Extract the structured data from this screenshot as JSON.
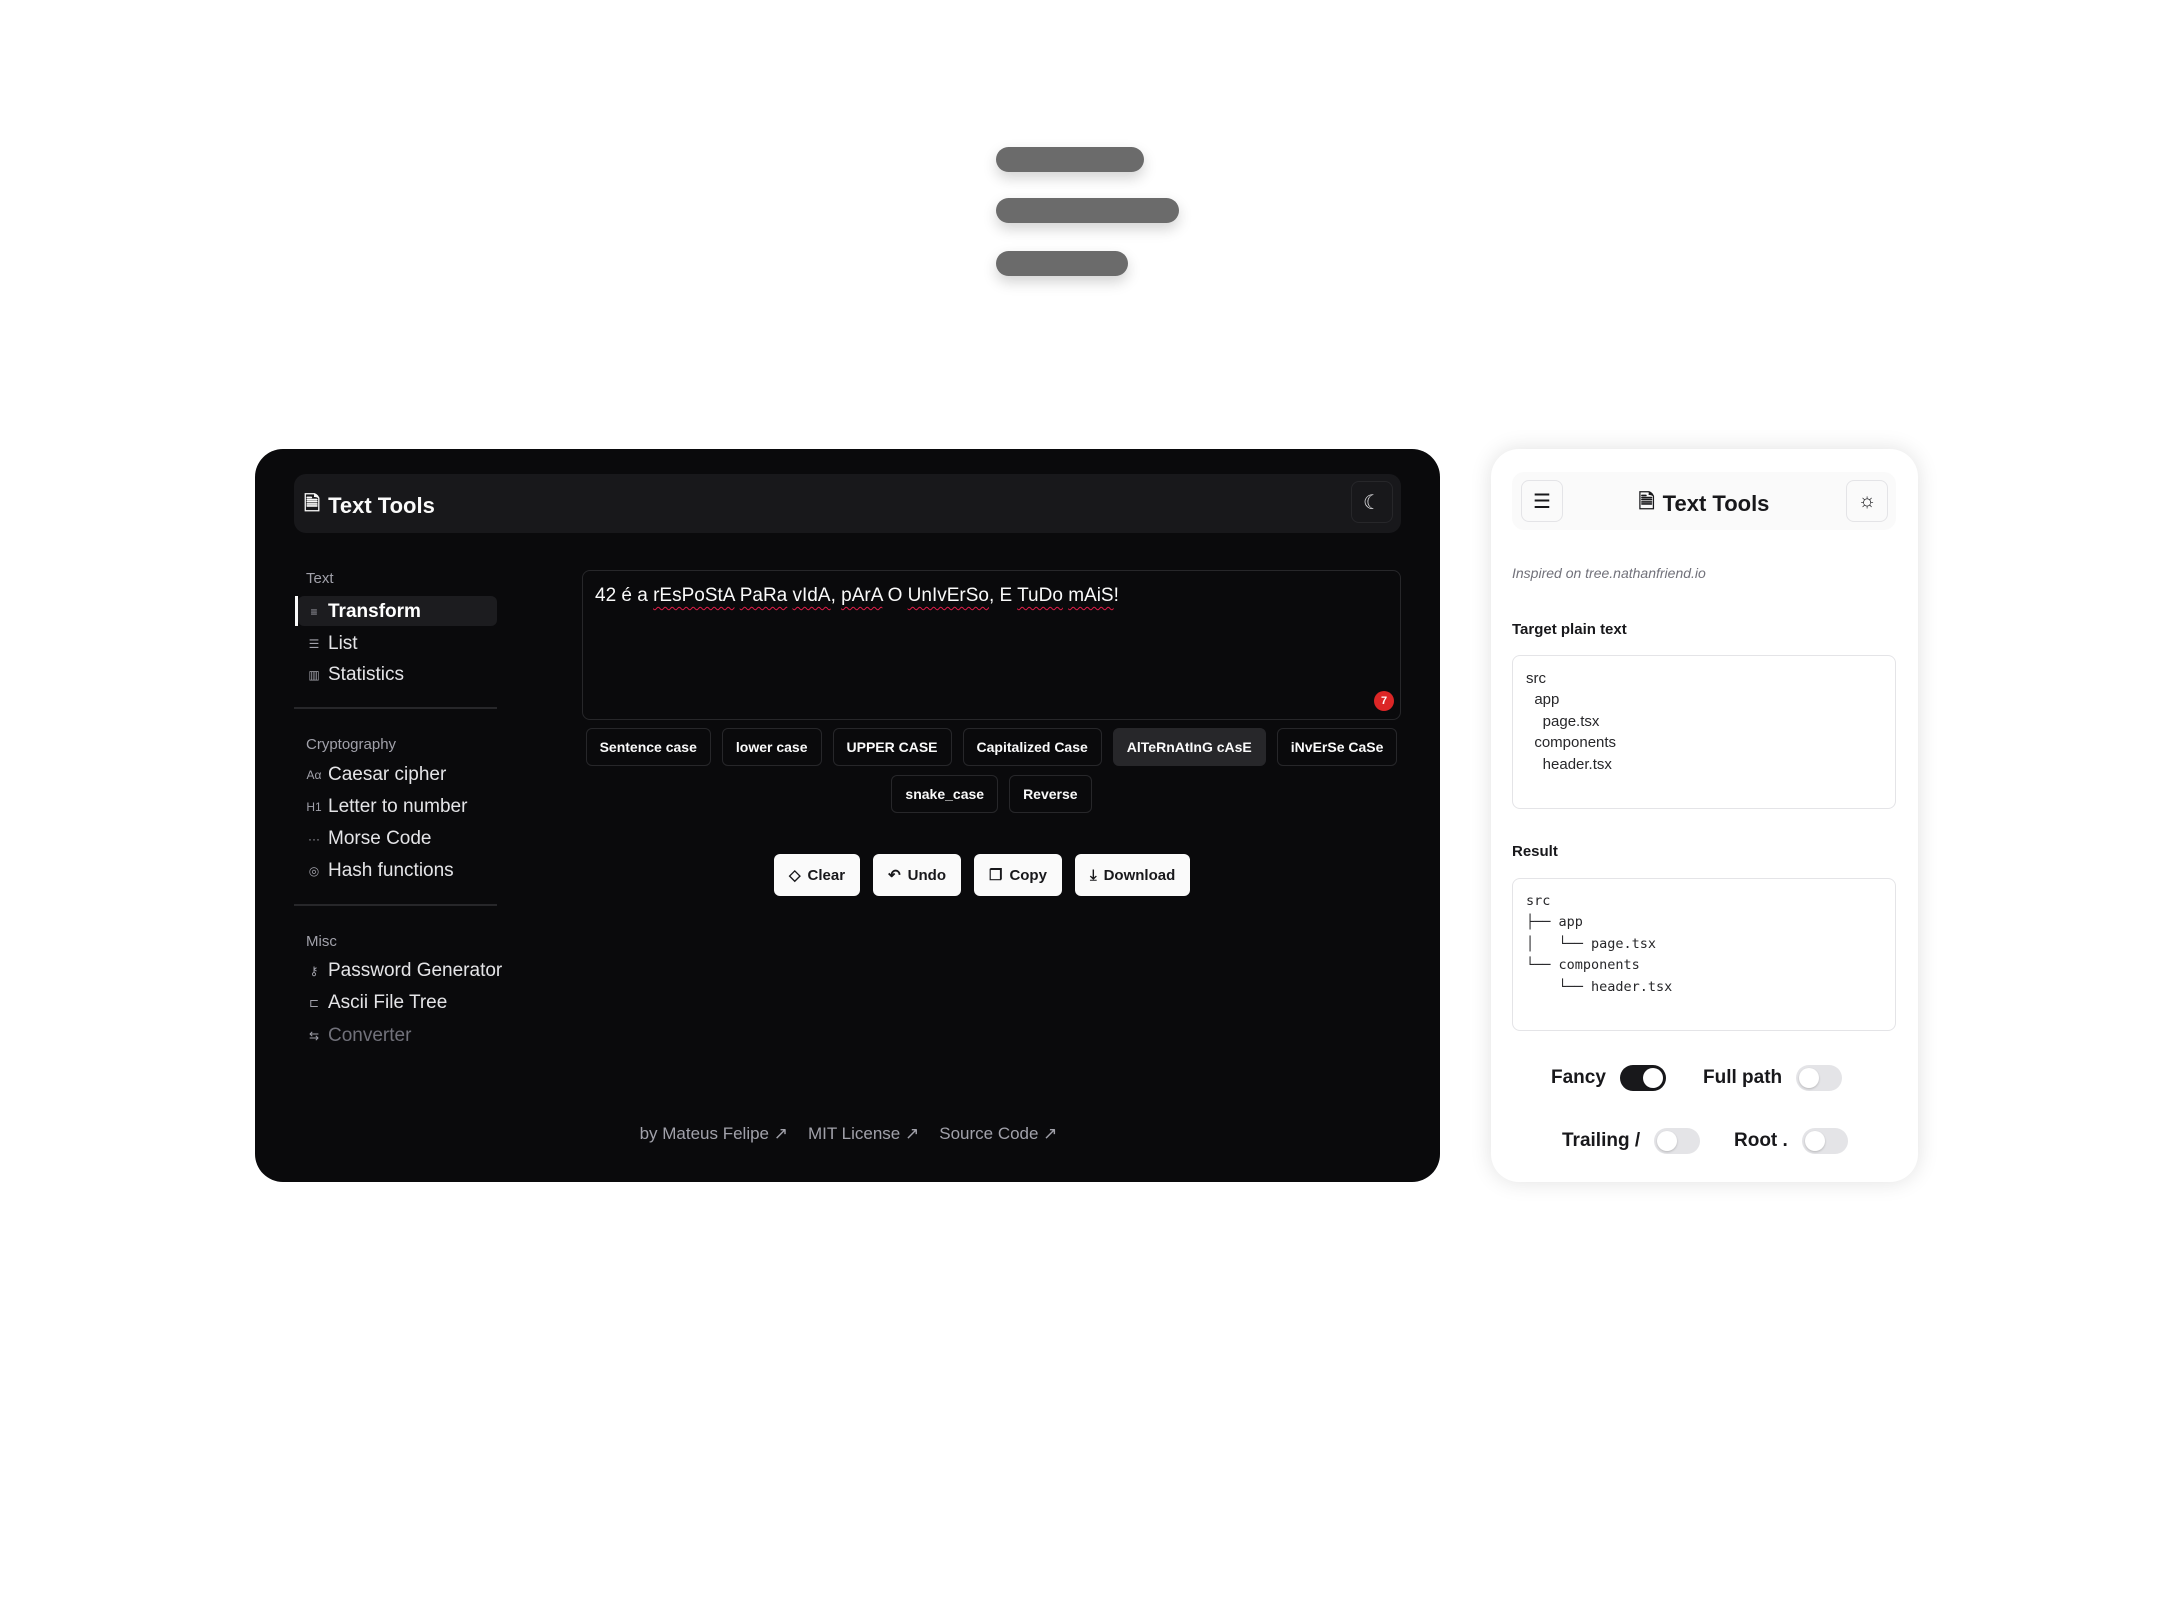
{
  "dark_app": {
    "title": "Text Tools",
    "theme_icon": "moon-icon",
    "sidebar": [
      {
        "section": "Text",
        "items": [
          {
            "label": "Transform",
            "icon": "≡",
            "active": true
          },
          {
            "label": "List",
            "icon": "☰"
          },
          {
            "label": "Statistics",
            "icon": "▥"
          }
        ]
      },
      {
        "section": "Cryptography",
        "items": [
          {
            "label": "Caesar cipher",
            "icon": "Aα"
          },
          {
            "label": "Letter to number",
            "icon": "H1"
          },
          {
            "label": "Morse Code",
            "icon": "···"
          },
          {
            "label": "Hash functions",
            "icon": "◎"
          }
        ]
      },
      {
        "section": "Misc",
        "items": [
          {
            "label": "Password Generator",
            "icon": "⚷"
          },
          {
            "label": "Ascii File Tree",
            "icon": "⊏"
          },
          {
            "label": "Converter",
            "icon": "⇆",
            "disabled": true
          }
        ]
      }
    ],
    "input_text": "42 é a rEsPoStA PaRa vIdA, pArA O UnIvErSo, E TuDo mAiS!",
    "error_count": "7",
    "case_buttons": [
      "Sentence case",
      "lower case",
      "UPPER CASE",
      "Capitalized Case",
      "AlTeRnAtInG cAsE",
      "iNvErSe CaSe"
    ],
    "case_buttons_row2": [
      "snake_case",
      "Reverse"
    ],
    "active_case": "AlTeRnAtInG cAsE",
    "actions": [
      {
        "label": "Clear",
        "icon": "◇"
      },
      {
        "label": "Undo",
        "icon": "↶"
      },
      {
        "label": "Copy",
        "icon": "❐"
      },
      {
        "label": "Download",
        "icon": "⤓"
      }
    ],
    "footer": [
      "by Mateus Felipe ↗",
      "MIT License ↗",
      "Source Code ↗"
    ]
  },
  "light_app": {
    "title": "Text Tools",
    "menu_icon": "menu-icon",
    "theme_icon": "sun-icon",
    "inspired_prefix": "Inspired on ",
    "inspired_link": "tree.nathanfriend.io",
    "target_label": "Target plain text",
    "target_text": "src\n  app\n    page.tsx\n  components\n    header.tsx",
    "result_label": "Result",
    "result_text": "src\n├── app\n│   └── page.tsx\n└── components\n    └── header.tsx",
    "toggles": [
      {
        "label": "Fancy",
        "on": true
      },
      {
        "label": "Full path",
        "on": false
      },
      {
        "label": "Trailing /",
        "on": false
      },
      {
        "label": "Root .",
        "on": false
      }
    ]
  },
  "colors": {
    "dark_bg": "#0a0a0c",
    "accent_error": "#dc2626",
    "logo_gray": "#6b6b6b"
  }
}
